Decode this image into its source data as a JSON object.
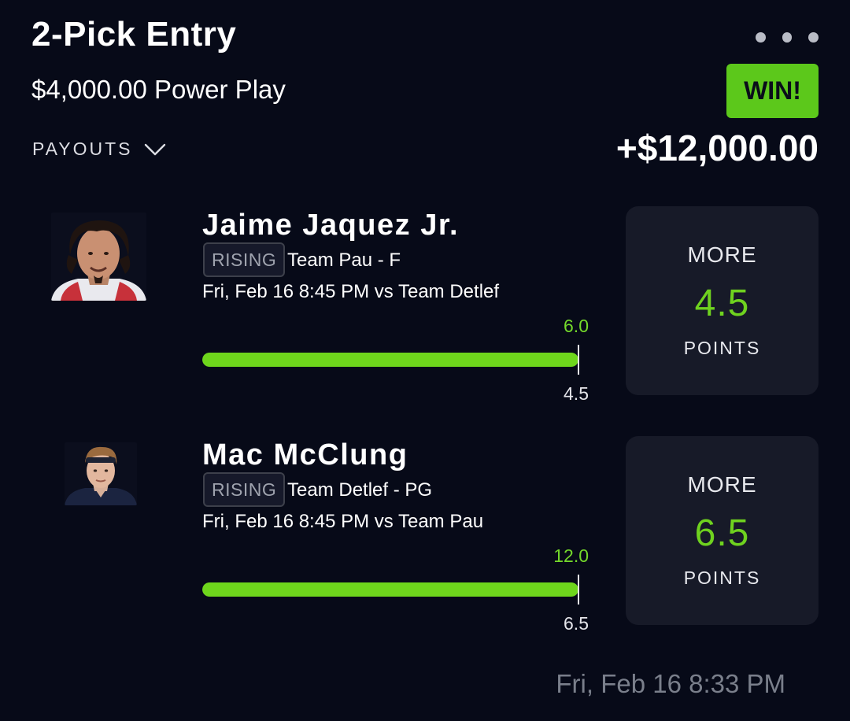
{
  "header": {
    "title": "2-Pick Entry",
    "entry_desc": "$4,000.00 Power Play",
    "result_badge": "WIN!",
    "payouts_label": "PAYOUTS",
    "winnings": "+$12,000.00"
  },
  "picks": [
    {
      "player": "Jaime Jaquez Jr.",
      "tag": "RISING",
      "team": "Team Pau - F",
      "game": "Fri, Feb 16 8:45 PM  vs Team Detlef",
      "actual": "6.0",
      "line": "4.5",
      "progress": 1.0,
      "direction": "MORE",
      "projection": "4.5",
      "stat": "POINTS"
    },
    {
      "player": "Mac McClung",
      "tag": "RISING",
      "team": "Team Detlef - PG",
      "game": "Fri, Feb 16 8:45 PM  vs Team Pau",
      "actual": "12.0",
      "line": "6.5",
      "progress": 1.0,
      "direction": "MORE",
      "projection": "6.5",
      "stat": "POINTS"
    }
  ],
  "footer": {
    "timestamp": "Fri, Feb 16 8:33 PM"
  },
  "colors": {
    "background": "#070a18",
    "accent_green": "#6ed61c",
    "win_badge": "#5cc81b",
    "card": "#171a28"
  },
  "icons": [
    "more-options-icon",
    "chevron-down-icon"
  ]
}
